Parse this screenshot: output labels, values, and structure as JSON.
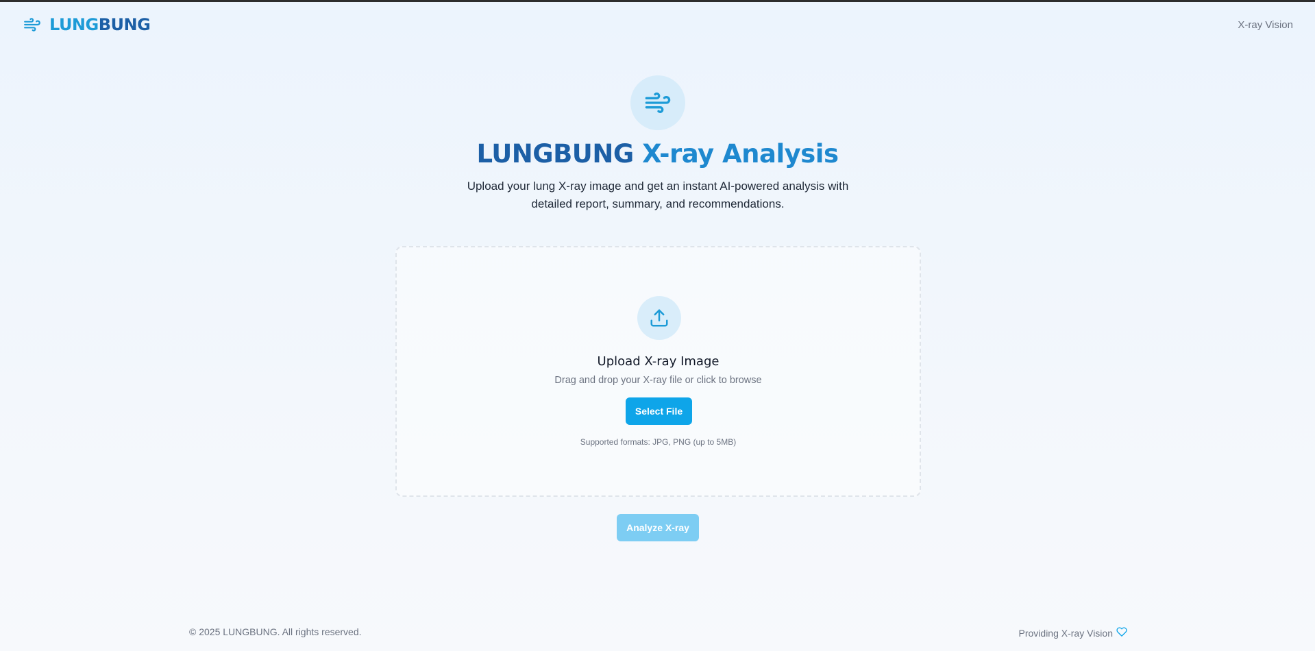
{
  "header": {
    "brand_part1": "LUNG",
    "brand_part2": "BUNG",
    "brand_icon": "wind-icon",
    "nav_link": "X-ray Vision"
  },
  "hero": {
    "icon": "wind-icon",
    "title_part1": "LUNGBUNG",
    "title_part2": "X-ray Analysis",
    "subtitle": "Upload your lung X-ray image and get an instant AI-powered analysis with detailed report, summary, and recommendations."
  },
  "dropzone": {
    "icon": "upload-icon",
    "title": "Upload X-ray Image",
    "hint": "Drag and drop your X-ray file or click to browse",
    "select_label": "Select File",
    "formats": "Supported formats: JPG, PNG (up to 5MB)"
  },
  "actions": {
    "analyze_label": "Analyze X-ray"
  },
  "footer": {
    "copyright": "© 2025 LUNGBUNG. All rights reserved.",
    "tagline": "Providing X-ray Vision",
    "tagline_icon": "heart-icon"
  },
  "colors": {
    "accent": "#0ea5e9",
    "brand_dark": "#1c5fa6",
    "brand_light": "#1d9bd7",
    "disabled_button": "#7dcdf3"
  }
}
